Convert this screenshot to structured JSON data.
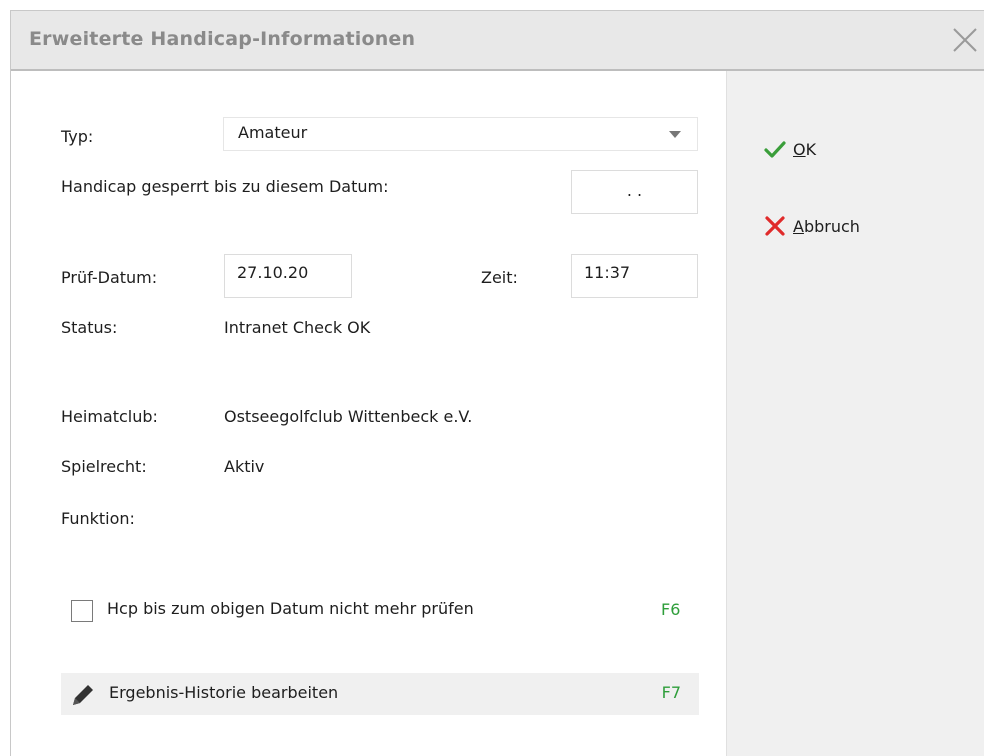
{
  "window": {
    "title": "Erweiterte Handicap-Informationen",
    "close_icon": "close-icon"
  },
  "form": {
    "typ_label": "Typ:",
    "typ_value": "Amateur",
    "gesperrt_label": "Handicap gesperrt bis zu diesem Datum:",
    "gesperrt_value": ". .",
    "pruefdatum_label": "Prüf-Datum:",
    "pruefdatum_value": "27.10.20",
    "zeit_label": "Zeit:",
    "zeit_value": "11:37",
    "status_label": "Status:",
    "status_value": "Intranet Check OK",
    "heimatclub_label": "Heimatclub:",
    "heimatclub_value": "Ostseegolfclub Wittenbeck e.V.",
    "spielrecht_label": "Spielrecht:",
    "spielrecht_value": "Aktiv",
    "funktion_label": "Funktion:",
    "funktion_value": ""
  },
  "options": {
    "checkbox_label": "Hcp bis zum obigen Datum nicht mehr prüfen",
    "checkbox_checked": false,
    "checkbox_fkey": "F6",
    "history_label": "Ergebnis-Historie bearbeiten",
    "history_fkey": "F7"
  },
  "sidebar": {
    "ok_mnemonic": "O",
    "ok_rest": "K",
    "cancel_mnemonic": "A",
    "cancel_rest": "bbruch"
  },
  "colors": {
    "ok_icon": "#3a9e3a",
    "cancel_icon": "#e02b2b",
    "fkey": "#2e9e3a",
    "title_text": "#8a8a8a"
  }
}
